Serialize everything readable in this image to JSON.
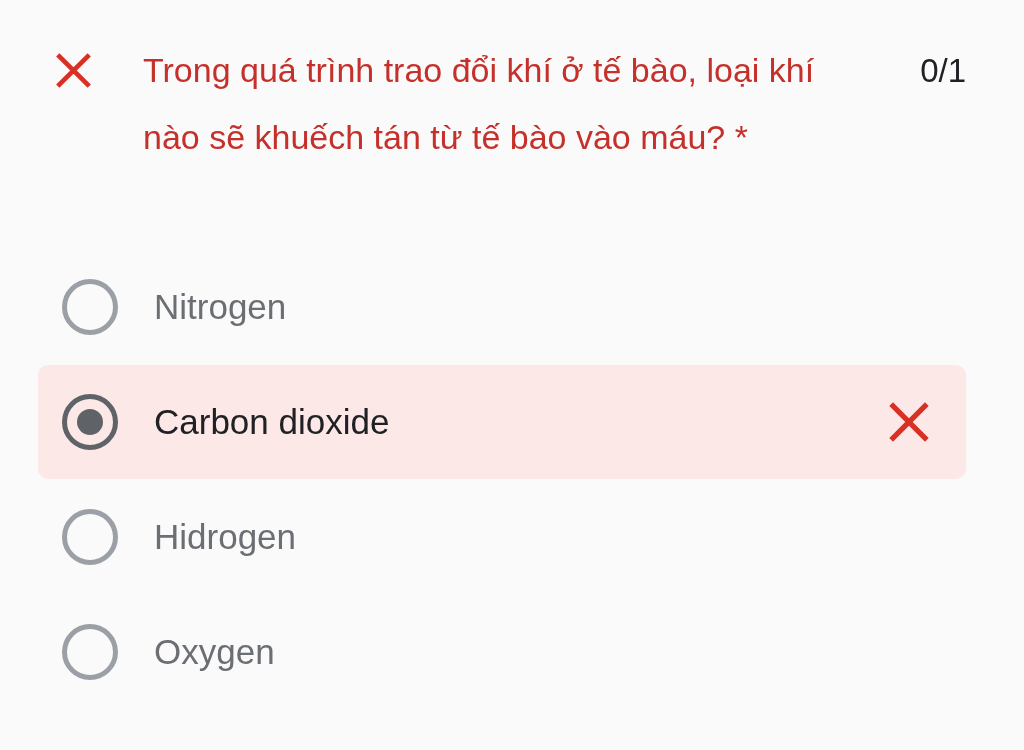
{
  "question": {
    "marked_wrong": true,
    "text": "Trong quá trình trao đổi khí ở tế bào, loại khí nào sẽ khuếch tán từ tế bào vào máu? *",
    "score": "0/1"
  },
  "options": [
    {
      "label": "Nitrogen",
      "selected": false,
      "marked_wrong": false
    },
    {
      "label": "Carbon dioxide",
      "selected": true,
      "marked_wrong": true
    },
    {
      "label": "Hidrogen",
      "selected": false,
      "marked_wrong": false
    },
    {
      "label": "Oxygen",
      "selected": false,
      "marked_wrong": false
    }
  ]
}
